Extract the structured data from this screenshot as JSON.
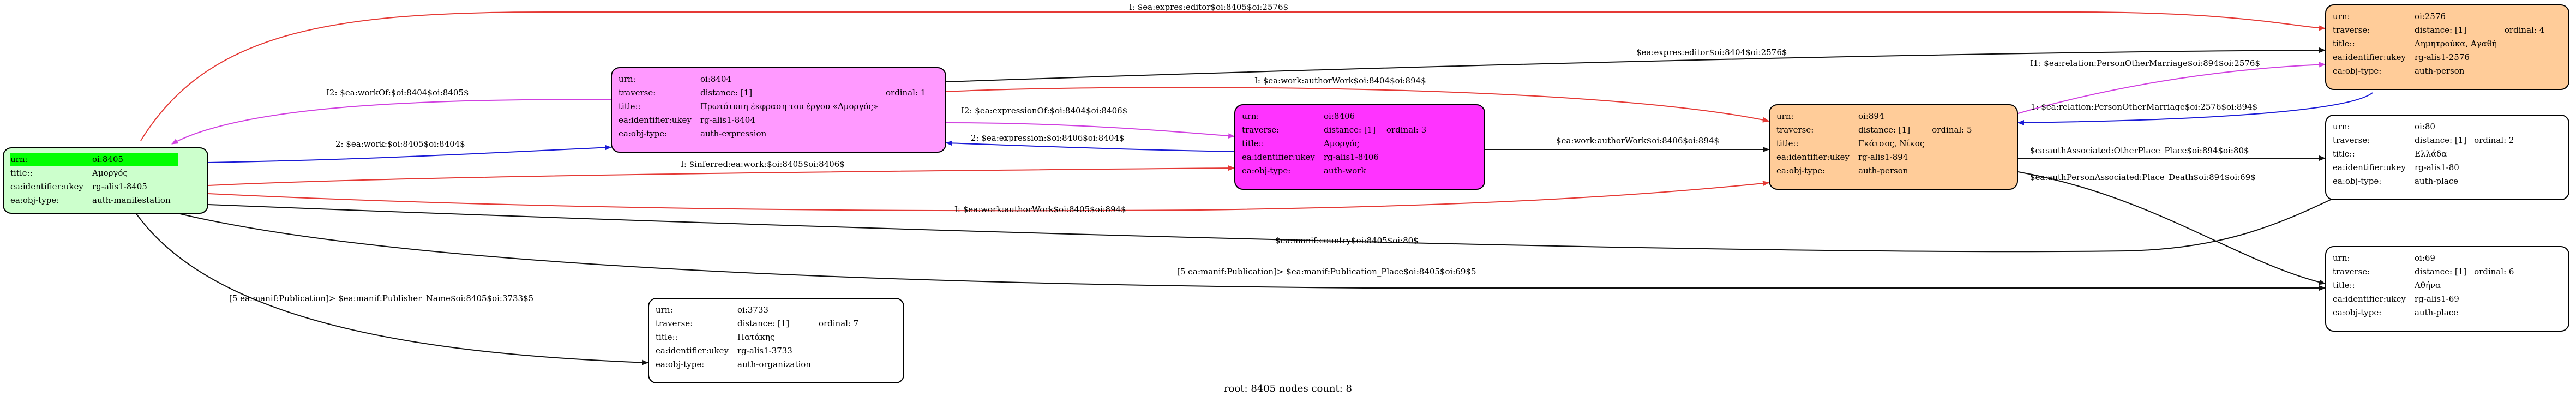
{
  "colors": {
    "red": "#e53935",
    "blue": "#1a1ad6",
    "magenta": "#d040e0",
    "black": "#111111"
  },
  "nodes": {
    "n8405": {
      "fill": "#ccffcc",
      "rows": [
        {
          "k": "urn:",
          "v": "oi:8405",
          "highlight": true
        },
        {
          "k": "title::",
          "v": "Αμοργός"
        },
        {
          "k": "ea:identifier:ukey",
          "v": "rg-alis1-8405"
        },
        {
          "k": "ea:obj-type:",
          "v": "auth-manifestation"
        }
      ]
    },
    "n8404": {
      "fill": "#ff99ff",
      "rows": [
        {
          "k": "urn:",
          "v": "oi:8404"
        },
        {
          "k": "traverse:",
          "v": "distance: [1]",
          "v2": "ordinal: 1"
        },
        {
          "k": "title::",
          "v": "Πρωτότυπη έκφραση του έργου «Αμοργός»"
        },
        {
          "k": "ea:identifier:ukey",
          "v": "rg-alis1-8404"
        },
        {
          "k": "ea:obj-type:",
          "v": "auth-expression"
        }
      ]
    },
    "n8406": {
      "fill": "#ff33ff",
      "rows": [
        {
          "k": "urn:",
          "v": "oi:8406"
        },
        {
          "k": "traverse:",
          "v": "distance: [1]",
          "v2": "ordinal: 3"
        },
        {
          "k": "title::",
          "v": "Αμοργός"
        },
        {
          "k": "ea:identifier:ukey",
          "v": "rg-alis1-8406"
        },
        {
          "k": "ea:obj-type:",
          "v": "auth-work"
        }
      ]
    },
    "n894": {
      "fill": "#ffcc99",
      "rows": [
        {
          "k": "urn:",
          "v": "oi:894"
        },
        {
          "k": "traverse:",
          "v": "distance: [1]",
          "v2": "ordinal: 5"
        },
        {
          "k": "title::",
          "v": "Γκάτσος, Νίκος"
        },
        {
          "k": "ea:identifier:ukey",
          "v": "rg-alis1-894"
        },
        {
          "k": "ea:obj-type:",
          "v": "auth-person"
        }
      ]
    },
    "n2576": {
      "fill": "#ffcc99",
      "rows": [
        {
          "k": "urn:",
          "v": "oi:2576"
        },
        {
          "k": "traverse:",
          "v": "distance: [1]",
          "v2": "ordinal: 4"
        },
        {
          "k": "title::",
          "v": "Δημητρούκα, Αγαθή"
        },
        {
          "k": "ea:identifier:ukey",
          "v": "rg-alis1-2576"
        },
        {
          "k": "ea:obj-type:",
          "v": "auth-person"
        }
      ]
    },
    "n80": {
      "fill": "#ffffff",
      "rows": [
        {
          "k": "urn:",
          "v": "oi:80"
        },
        {
          "k": "traverse:",
          "v": "distance: [1]",
          "v2": "ordinal: 2"
        },
        {
          "k": "title::",
          "v": "Ελλάδα"
        },
        {
          "k": "ea:identifier:ukey",
          "v": "rg-alis1-80"
        },
        {
          "k": "ea:obj-type:",
          "v": "auth-place"
        }
      ]
    },
    "n69": {
      "fill": "#ffffff",
      "rows": [
        {
          "k": "urn:",
          "v": "oi:69"
        },
        {
          "k": "traverse:",
          "v": "distance: [1]",
          "v2": "ordinal: 6"
        },
        {
          "k": "title::",
          "v": "Αθήνα"
        },
        {
          "k": "ea:identifier:ukey",
          "v": "rg-alis1-69"
        },
        {
          "k": "ea:obj-type:",
          "v": "auth-place"
        }
      ]
    },
    "n3733": {
      "fill": "#ffffff",
      "rows": [
        {
          "k": "urn:",
          "v": "oi:3733"
        },
        {
          "k": "traverse:",
          "v": "distance: [1]",
          "v2": "ordinal: 7"
        },
        {
          "k": "title::",
          "v": "Πατάκης"
        },
        {
          "k": "ea:identifier:ukey",
          "v": "rg-alis1-3733"
        },
        {
          "k": "ea:obj-type:",
          "v": "auth-organization"
        }
      ]
    }
  },
  "edges": [
    {
      "label": "I: $ea:expres:editor$oi:8405$oi:2576$",
      "color": "red"
    },
    {
      "label": "$ea:expres:editor$oi:8404$oi:2576$",
      "color": "black"
    },
    {
      "label": "I: $ea:work:authorWork$oi:8404$oi:894$",
      "color": "red"
    },
    {
      "label": "I2: $ea:workOf:$oi:8404$oi:8405$",
      "color": "magenta"
    },
    {
      "label": "2: $ea:work:$oi:8405$oi:8404$",
      "color": "blue"
    },
    {
      "label": "I2: $ea:expressionOf:$oi:8404$oi:8406$",
      "color": "magenta"
    },
    {
      "label": "2: $ea:expression:$oi:8406$oi:8404$",
      "color": "blue"
    },
    {
      "label": "I: $inferred:ea:work:$oi:8405$oi:8406$",
      "color": "red"
    },
    {
      "label": "$ea:work:authorWork$oi:8406$oi:894$",
      "color": "black"
    },
    {
      "label": "I: $ea:work:authorWork$oi:8405$oi:894$",
      "color": "red"
    },
    {
      "label": "I1: $ea:relation:PersonOtherMarriage$oi:894$oi:2576$",
      "color": "magenta"
    },
    {
      "label": "1: $ea:relation:PersonOtherMarriage$oi:2576$oi:894$",
      "color": "blue"
    },
    {
      "label": "$ea:authAssociated:OtherPlace_Place$oi:894$oi:80$",
      "color": "black"
    },
    {
      "label": "$ea:authPersonAssociated:Place_Death$oi:894$oi:69$",
      "color": "black"
    },
    {
      "label": "$ea:manif:country$oi:8405$oi:80$",
      "color": "black"
    },
    {
      "label": "[5 ea:manif:Publication]> $ea:manif:Publication_Place$oi:8405$oi:69$5",
      "color": "black"
    },
    {
      "label": "[5 ea:manif:Publication]> $ea:manif:Publisher_Name$oi:8405$oi:3733$5",
      "color": "black"
    }
  ],
  "footer": "root: 8405 nodes count: 8"
}
